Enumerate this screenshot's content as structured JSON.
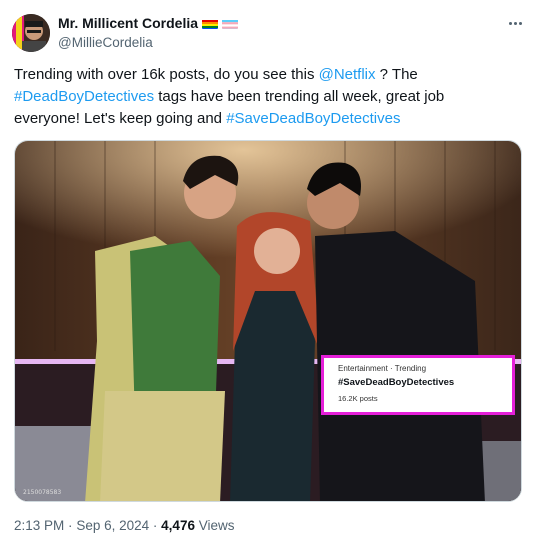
{
  "author": {
    "display_name": "Mr. Millicent Cordelia",
    "handle": "@MillieCordelia",
    "badges": [
      "rainbow-flag-icon",
      "trans-flag-icon"
    ]
  },
  "post": {
    "text_parts": [
      {
        "text": "Trending with over 16k posts, do you see this ",
        "type": "text"
      },
      {
        "text": "@Netflix",
        "type": "mention"
      },
      {
        "text": " ? The ",
        "type": "text"
      },
      {
        "text": "#DeadBoyDetectives",
        "type": "hashtag"
      },
      {
        "text": " tags have been trending all week, great job everyone! Let's keep going and ",
        "type": "text"
      },
      {
        "text": "#SaveDeadBoyDetectives",
        "type": "hashtag"
      }
    ]
  },
  "media": {
    "photo_id": "2150078583",
    "trend_card": {
      "category": "Entertainment · Trending",
      "hashtag": "#SaveDeadBoyDetectives",
      "count": "16.2K posts",
      "border_color": "#e51fd9"
    }
  },
  "footer": {
    "time": "2:13 PM",
    "separator": "·",
    "date": "Sep 6, 2024",
    "views_count": "4,476",
    "views_label": "Views"
  },
  "colors": {
    "link": "#1d9bf0",
    "muted": "#536471",
    "text": "#0f1419"
  },
  "icons": {
    "more": "more-horizontal-icon"
  }
}
